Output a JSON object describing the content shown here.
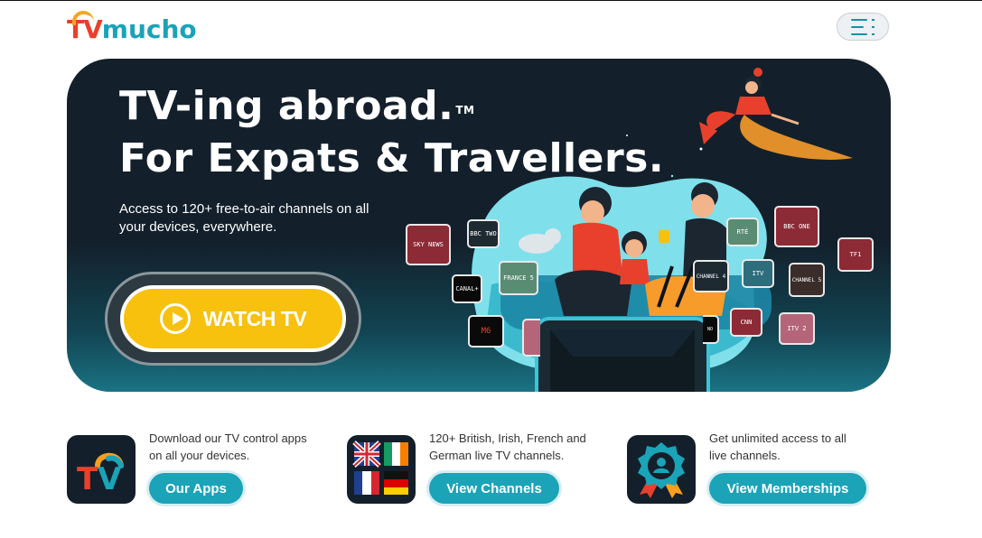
{
  "header": {
    "logo_tv": "TV",
    "logo_mucho": "mucho",
    "menu_icon": "hamburger-menu-icon"
  },
  "hero": {
    "title_line1": "TV-ing abroad.",
    "trademark": "TM",
    "title_line2": "For Expats & Travellers.",
    "subtitle": "Access to 120+ free-to-air channels on all your devices, everywhere.",
    "watch_button": "WATCH TV",
    "channels": [
      "SKY NEWS",
      "BBC TWO",
      "FRANCE 5",
      "CANAL+",
      "M6",
      "RTÉ",
      "BBC ONE",
      "TF1",
      "ITV",
      "CHANNEL 4",
      "CHANNEL 5",
      "CNN",
      "ITV 2",
      "NO"
    ]
  },
  "features": [
    {
      "text": "Download our TV control apps on all your devices.",
      "button": "Our Apps"
    },
    {
      "text": "120+ British, Irish, French and German live TV channels.",
      "button": "View Channels"
    },
    {
      "text": "Get unlimited access to all live channels.",
      "button": "View Memberships"
    }
  ],
  "colors": {
    "brand_teal": "#1ba3b8",
    "brand_red": "#e8402c",
    "brand_yellow": "#f7c10e",
    "hero_bg": "#13202b"
  }
}
